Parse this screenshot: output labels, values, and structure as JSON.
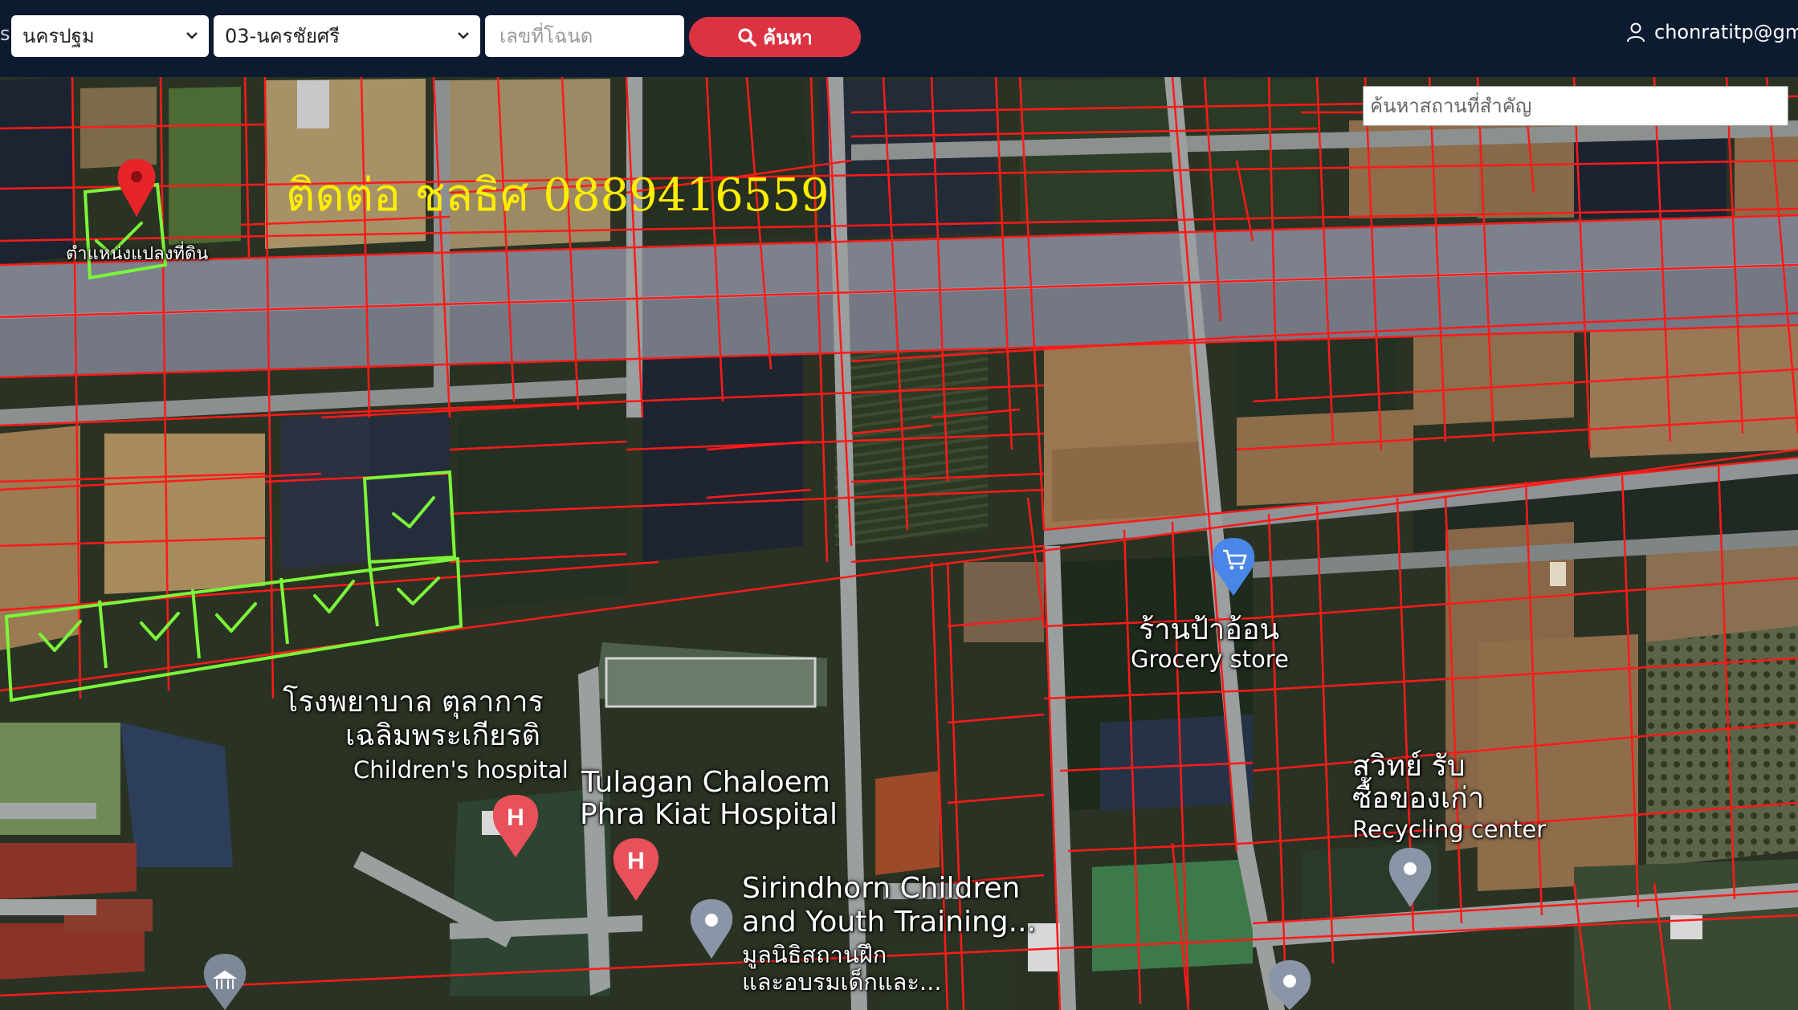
{
  "header": {
    "edge_text": "s",
    "province": "นครปฐม",
    "district": "03-นครชัยศรี",
    "deed_placeholder": "เลขที่โฉนด",
    "search_label": "ค้นหา",
    "user": "chonratitp@gm"
  },
  "map": {
    "place_search_placeholder": "ค้นหาสถานที่สำคัญ",
    "contact_text": "ติดต่อ ชลธิศ 0889416559",
    "pin_label": "ตำแหน่งแปลงที่ดิน",
    "labels": {
      "grocery_th": "ร้านป้าอ้อน",
      "grocery_en": "Grocery store",
      "hospital_th_1": "โรงพยาบาล ตุลาการ",
      "hospital_th_2": "เฉลิมพระเกียรติ",
      "hospital_en": "Children's hospital",
      "tulagan_1": "Tulagan Chaloem",
      "tulagan_2": "Phra Kiat Hospital",
      "recycling_th_1": "สุวิทย์ รับ",
      "recycling_th_2": "ซื้อของเก่า",
      "recycling_en": "Recycling center",
      "sirindhorn_1": "Sirindhorn Children",
      "sirindhorn_2": "and Youth Training...",
      "sirindhorn_th_1": "มูลนิธิสถานฝึก",
      "sirindhorn_th_2": "และอบรมเด็กและ..."
    },
    "colors": {
      "parcel_line": "#ff1a1a",
      "selection_outline": "#7cf53a",
      "header_bg": "#0d1b31",
      "search_button": "#dc3342",
      "contact_text": "#ffee00"
    },
    "icons": [
      "location-pin-icon",
      "shopping-cart-icon",
      "hospital-icon",
      "place-pin-icon",
      "museum-icon",
      "user-icon",
      "search-icon",
      "chevron-down-icon",
      "check-mark-icon"
    ]
  }
}
